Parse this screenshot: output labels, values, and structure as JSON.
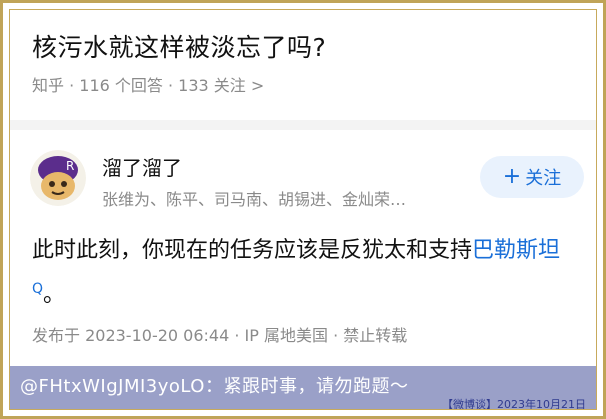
{
  "question": {
    "title": "核污水就这样被淡忘了吗?",
    "meta": "知乎 · 116 个回答 · 133 关注 >"
  },
  "author": {
    "name": "溜了溜了",
    "sub": "张维为、陈平、司马南、胡锡进、金灿荣…"
  },
  "follow_button": {
    "plus": "+",
    "label": "关注"
  },
  "answer": {
    "text_before": "此时此刻，你现在的任务应该是反犹太和支持",
    "link_text": "巴勒斯坦",
    "search_mark": "Q",
    "text_after": "。"
  },
  "post_meta": "发布于 2023-10-20 06:44 · IP 属地美国 · 禁止转载",
  "banner": {
    "text": "@FHtxWIgJMI3yoLO：紧跟时事，请勿跑题～",
    "stamp": "【微博谈】2023年10月21日"
  },
  "colors": {
    "frame": "#c0a458",
    "link": "#1a6fd8",
    "banner": "#9aa0c8"
  }
}
